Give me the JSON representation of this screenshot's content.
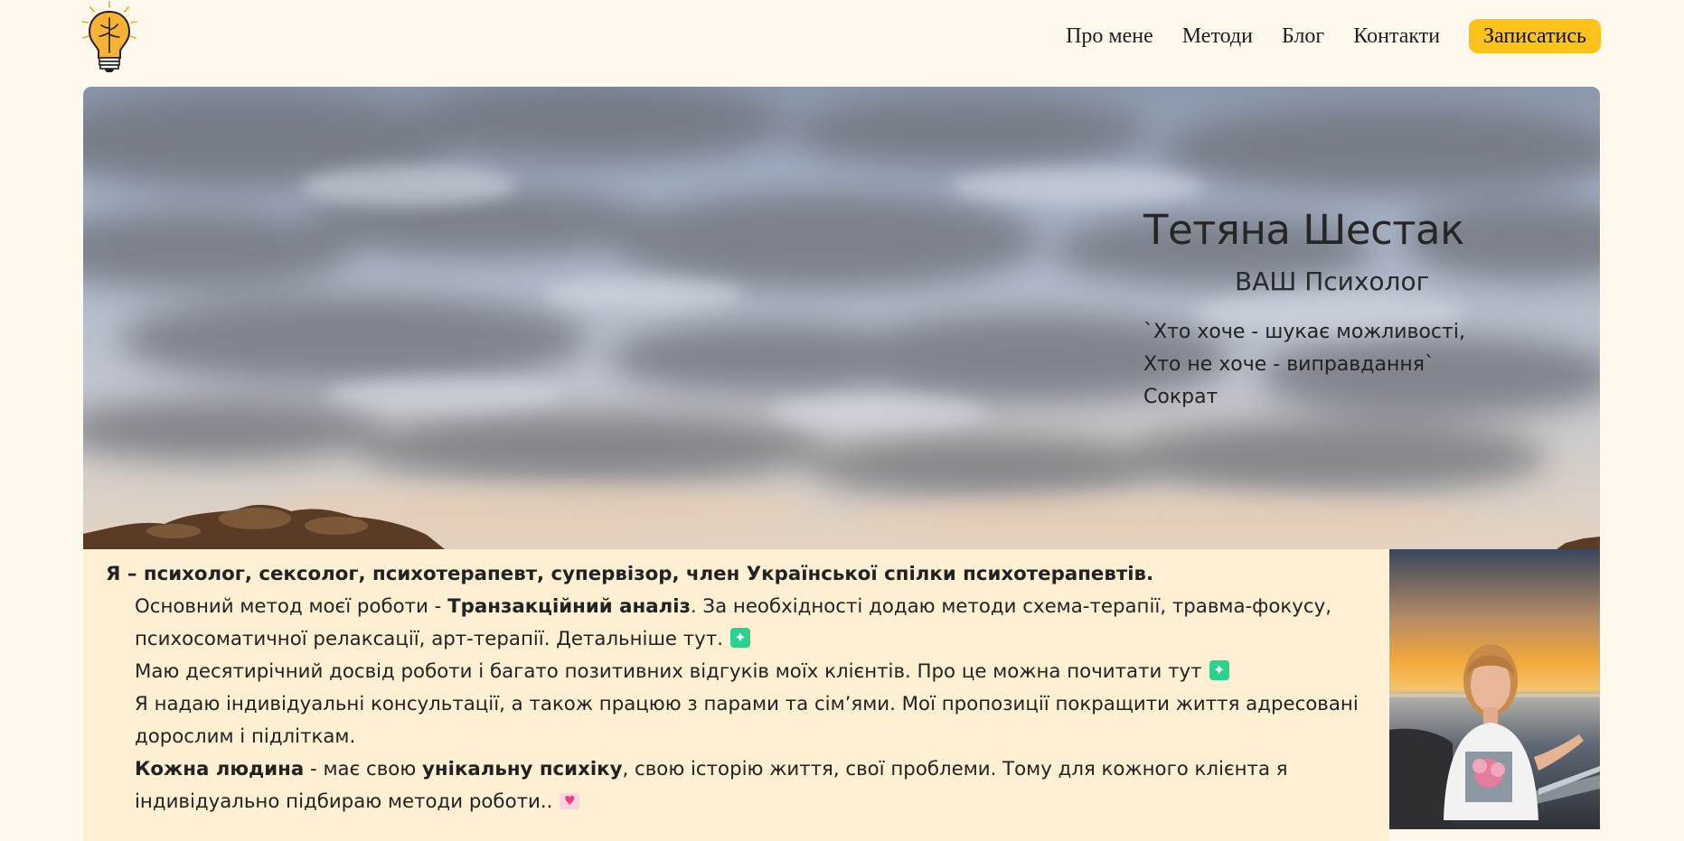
{
  "header": {
    "logo": "lightbulb-brain-logo",
    "nav": [
      {
        "label": "Про мене"
      },
      {
        "label": "Методи"
      },
      {
        "label": "Блог"
      },
      {
        "label": "Контакти"
      }
    ],
    "cta_label": "Записатись",
    "cta_color": "#fdc21b"
  },
  "hero": {
    "name": "Тетяна Шестак",
    "subtitle": "ВАШ Психолог",
    "quote": {
      "line1": "`Хто хоче - шукає можливості,",
      "line2": "Хто не хоче - виправдання`",
      "author": "Сократ"
    }
  },
  "about": {
    "intro": "Я – психолог, сексолог, психотерапевт, супервізор, член Української спілки психотерапевтів.",
    "p1": {
      "before": "Основний метод моєї роботи - ",
      "bold": "Транзакційний аналіз",
      "after": ". За необхідності додаю методи схема-терапії, травма-фокусу, психосоматичної релаксації, арт-терапії. Детальніше тут."
    },
    "p2": "Маю десятирічний досвід роботи і багато позитивних відгуків моїх клієнтів. Про це можна почитати тут",
    "p3": "Я надаю індивідуальні консультації, а також працюю з парами та сім’ями. Мої пропозиції покращити життя адресовані дорослим і підліткам.",
    "p4": {
      "bold1": "Кожна людина",
      "text1": " - має свою ",
      "bold2": "унікальну психіку",
      "text2": ", свою історію життя, свої проблеми. Тому для кожного клієнта я індивідуально підбираю методи роботи.."
    },
    "background_color": "#fff0d4"
  },
  "page_background": "#fff8ec"
}
